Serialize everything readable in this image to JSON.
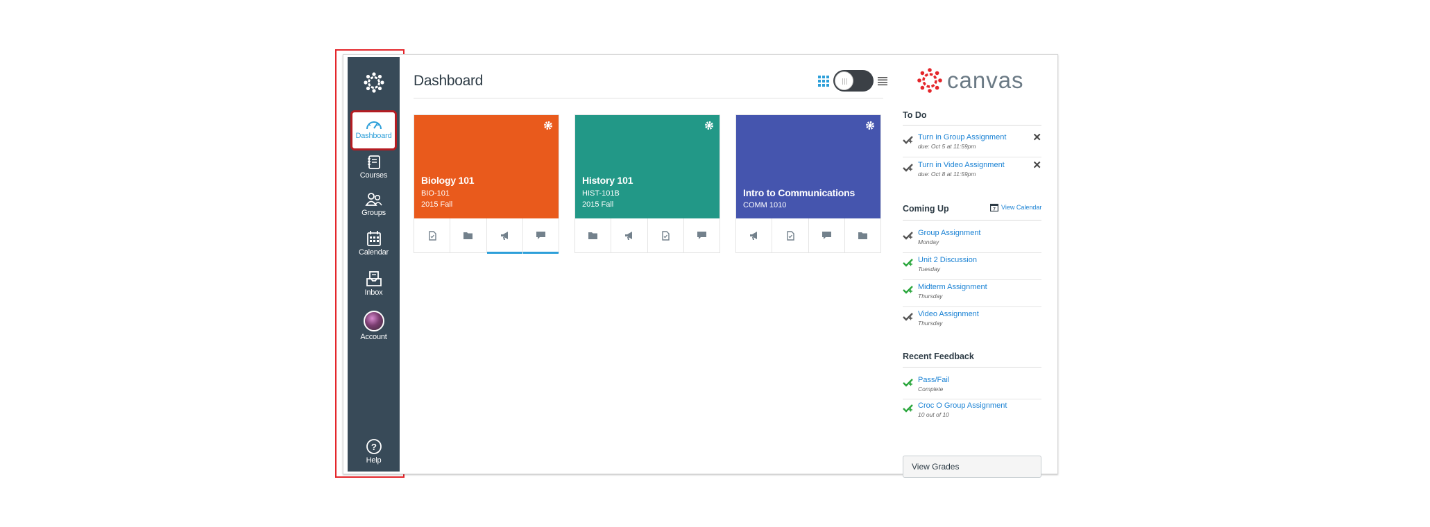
{
  "nav": {
    "dashboard": "Dashboard",
    "courses": "Courses",
    "groups": "Groups",
    "calendar": "Calendar",
    "inbox": "Inbox",
    "account": "Account",
    "help": "Help"
  },
  "page": {
    "title": "Dashboard"
  },
  "cards": [
    {
      "name": "Biology 101",
      "code": "BIO-101",
      "term": "2015 Fall",
      "color": "#e95a1c"
    },
    {
      "name": "History 101",
      "code": "HIST-101B",
      "term": "2015 Fall",
      "color": "#229887"
    },
    {
      "name": "Intro to Communications",
      "code": "COMM 1010",
      "term": "",
      "color": "#4555ae"
    }
  ],
  "icons": {
    "card_actions": [
      [
        "assignments-icon",
        "files-icon",
        "announcements-icon",
        "discussions-icon"
      ],
      [
        "files-icon",
        "announcements-icon",
        "assignments-icon",
        "discussions-icon"
      ],
      [
        "announcements-icon",
        "assignments-icon",
        "discussions-icon",
        "files-icon"
      ]
    ]
  },
  "sidebar": {
    "brand": "canvas",
    "brand_color": "#e4262b",
    "todo": {
      "heading": "To Do",
      "items": [
        {
          "title": "Turn in Group Assignment",
          "sub": "due: Oct 5 at 11:59pm"
        },
        {
          "title": "Turn in Video Assignment",
          "sub": "due: Oct 8 at 11:59pm"
        }
      ]
    },
    "coming_up": {
      "heading": "Coming Up",
      "view_calendar": "View Calendar",
      "items": [
        {
          "title": "Group Assignment",
          "sub": "Monday"
        },
        {
          "title": "Unit 2 Discussion",
          "sub": "Tuesday"
        },
        {
          "title": "Midterm Assignment",
          "sub": "Thursday"
        },
        {
          "title": "Video Assignment",
          "sub": "Thursday"
        }
      ]
    },
    "feedback": {
      "heading": "Recent Feedback",
      "items": [
        {
          "title": "Pass/Fail",
          "sub": "Complete"
        },
        {
          "title": "Croc O Group Assignment",
          "sub": "10 out of 10"
        }
      ]
    },
    "view_grades": "View Grades"
  },
  "colors": {
    "nav_bg": "#384a58",
    "link": "#1a82d4",
    "active_border": "#b41c22",
    "highlight": "#e4262b"
  }
}
